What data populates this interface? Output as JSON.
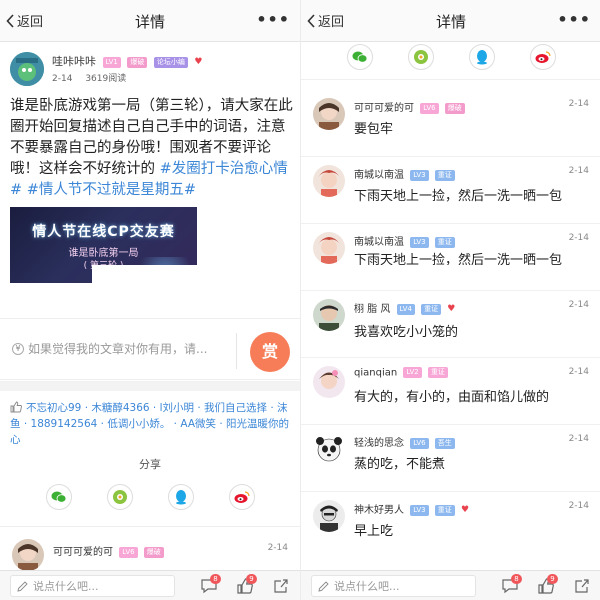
{
  "left": {
    "nav": {
      "back": "返回",
      "title": "详情",
      "more": "•••"
    },
    "author": {
      "name": "哇咔咔咔",
      "badges": [
        "LV1",
        "爆破",
        "论坛小编"
      ],
      "date": "2-14",
      "reads": "3619阅读"
    },
    "post": {
      "text": "谁是卧底游戏第一局（第三轮），请大家在此圈开始回复描述自己自己手中的词语，注意不要暴露自己的身份哦！围观者不要评论哦！这样会不好统计的 ",
      "topic": "#发圈打卡治愈心情# #情人节不过就是星期五#",
      "image_title": "情人节在线CP交友赛",
      "image_sub": "谁是卧底第一局",
      "image_sub2": "( 第三轮 )"
    },
    "reward": {
      "placeholder": "如果觉得我的文章对你有用，请...",
      "button": "赏"
    },
    "likes": "不忘初心99 · 木糖醇4366 · l刘小明 · 我们自己选择 · 沫鱼 · 1889142564 · 低调小小娇。 · AA微笑 · 阳光温暖你的心",
    "share_title": "分享",
    "first_comment": {
      "name": "可可可爱的可",
      "badges": [
        "LV6",
        "爆破"
      ],
      "time": "2-14"
    },
    "bottom": {
      "placeholder": "说点什么吧...",
      "comment_count": "8",
      "like_count": "9"
    }
  },
  "right": {
    "nav": {
      "back": "返回",
      "title": "详情",
      "more": "•••"
    },
    "comments": [
      {
        "name": "可可可爱的可",
        "badges": [
          "LV6",
          "爆破"
        ],
        "time": "2-14",
        "text": "要包牢"
      },
      {
        "name": "南城以南温",
        "badges": [
          "LV3",
          "重证"
        ],
        "time": "2-14",
        "text": "下雨天地上一捡，然后一洗一晒一包"
      },
      {
        "name": "南城以南温",
        "badges": [
          "LV3",
          "重证"
        ],
        "time": "2-14",
        "text": "下雨天地上一捡，然后一洗一晒一包"
      },
      {
        "name": "栩 脂 风",
        "badges": [
          "LV4",
          "重证"
        ],
        "time": "2-14",
        "text": "我喜欢吃小小笼的"
      },
      {
        "name": "qianqian",
        "badges": [
          "LV2",
          "重证"
        ],
        "time": "2-14",
        "text": "有大的，有小的，由面和馅儿做的"
      },
      {
        "name": "轻浅的思念",
        "badges": [
          "LV6",
          "吾生"
        ],
        "time": "2-14",
        "text": "蒸的吃，不能煮"
      },
      {
        "name": "神木好男人",
        "badges": [
          "LV3",
          "重证"
        ],
        "time": "2-14",
        "text": "早上吃"
      }
    ],
    "bottom": {
      "placeholder": "说点什么吧...",
      "comment_count": "8",
      "like_count": "9"
    }
  },
  "colors": {
    "accent_blue": "#3b86d6",
    "reward_orange": "#f67d58",
    "badge_pink": "#f39ccc",
    "heart_red": "#e8434e"
  },
  "icons": [
    "back-chevron-icon",
    "more-icon",
    "yen-icon",
    "thumb-up-icon",
    "wechat-icon",
    "moments-icon",
    "qq-icon",
    "weibo-icon",
    "pencil-icon",
    "comment-icon",
    "like-icon",
    "share-icon",
    "heart-icon"
  ]
}
